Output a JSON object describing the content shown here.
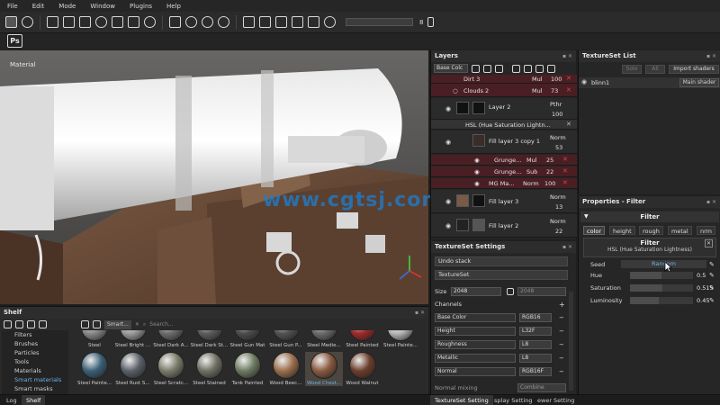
{
  "menu": [
    "File",
    "Edit",
    "Mode",
    "Window",
    "Plugins",
    "Help"
  ],
  "toolbar": {
    "size_value": "8"
  },
  "viewport": {
    "label": "Material"
  },
  "watermark": "www.cgtsj.com",
  "shelf": {
    "title": "Shelf",
    "search_chip": "Smart...",
    "search_placeholder": "Search...",
    "categories": [
      "Filters",
      "Brushes",
      "Particles",
      "Tools",
      "Materials",
      "Smart materials",
      "Smart masks"
    ],
    "selected_category": "Smart materials",
    "row1": [
      "Steel",
      "Steel Bright ...",
      "Steel Dark A...",
      "Steel Dark St...",
      "Steel Gun Mat",
      "Steel Gun P...",
      "Steel Medie...",
      "Steel Painted",
      "Steel Painte..."
    ],
    "row2": [
      "Steel Painte...",
      "Steel Rust S...",
      "Steel Scratc...",
      "Steel Stained",
      "Tank Painted",
      "Wood Beec...",
      "Wood Chest...",
      "Wood Walnut"
    ],
    "highlighted_item": "Wood Chest..."
  },
  "bottom_tabs": [
    "Log",
    "Shelf",
    "TextureSet Setting",
    "splay Setting",
    "ewer Setting"
  ],
  "layers": {
    "title": "Layers",
    "blend_select": "Base Colc",
    "rows": [
      {
        "name": "Dirt 3",
        "blend": "Mul",
        "value": "100"
      },
      {
        "name": "Clouds 2",
        "blend": "Mul",
        "value": "73"
      },
      {
        "name": "Layer 2",
        "blend": "Pthr",
        "value": "100"
      },
      {
        "name": "HSL (Hue Saturation Lightn...",
        "blend": "",
        "value": ""
      },
      {
        "name": "Fill layer 3 copy 1",
        "blend": "Norm",
        "value": "53"
      },
      {
        "name": "Grunge...",
        "blend": "Mul",
        "value": "25"
      },
      {
        "name": "Grunge...",
        "blend": "Sub",
        "value": "22"
      },
      {
        "name": "MG Ma...",
        "blend": "Norm",
        "value": "100"
      },
      {
        "name": "Fill layer 3",
        "blend": "Norm",
        "value": "13"
      },
      {
        "name": "Fill layer 2",
        "blend": "Norm",
        "value": "22"
      }
    ]
  },
  "tss": {
    "title": "TextureSet Settings",
    "undo": "Undo stack",
    "textureset": "TextureSet",
    "size_label": "Size",
    "size_value": "2048",
    "size_value2": "2048",
    "channels_label": "Channels",
    "channels": [
      {
        "name": "Base Color",
        "format": "RGB16"
      },
      {
        "name": "Height",
        "format": "L32F"
      },
      {
        "name": "Roughness",
        "format": "L8"
      },
      {
        "name": "Metallic",
        "format": "L8"
      },
      {
        "name": "Normal",
        "format": "RGB16F"
      }
    ],
    "normal_mixing": "Normal mixing",
    "combine": "Combine"
  },
  "tslist": {
    "title": "TextureSet List",
    "solo": "Solo",
    "all": "All",
    "import": "Import shaders",
    "item": "blinn1",
    "shader": "Main shader"
  },
  "props": {
    "title": "Properties - Filter",
    "section": "Filter",
    "channels": [
      "color",
      "height",
      "rough",
      "metal",
      "nrm"
    ],
    "active_channel": "color",
    "filter_label": "Filter",
    "filter_name": "HSL (Hue Saturation Lightness)",
    "seed_label": "Seed",
    "seed_value": "Random",
    "params": [
      {
        "name": "Hue",
        "value": "0.5",
        "fraction": 0.5
      },
      {
        "name": "Saturation",
        "value": "0.515",
        "fraction": 0.515
      },
      {
        "name": "Luminosity",
        "value": "0.45",
        "fraction": 0.45
      }
    ]
  },
  "colors": {
    "accent": "#6fb2e8",
    "layer_mask_bg": "#4a1f24",
    "delete": "#dd4444"
  }
}
